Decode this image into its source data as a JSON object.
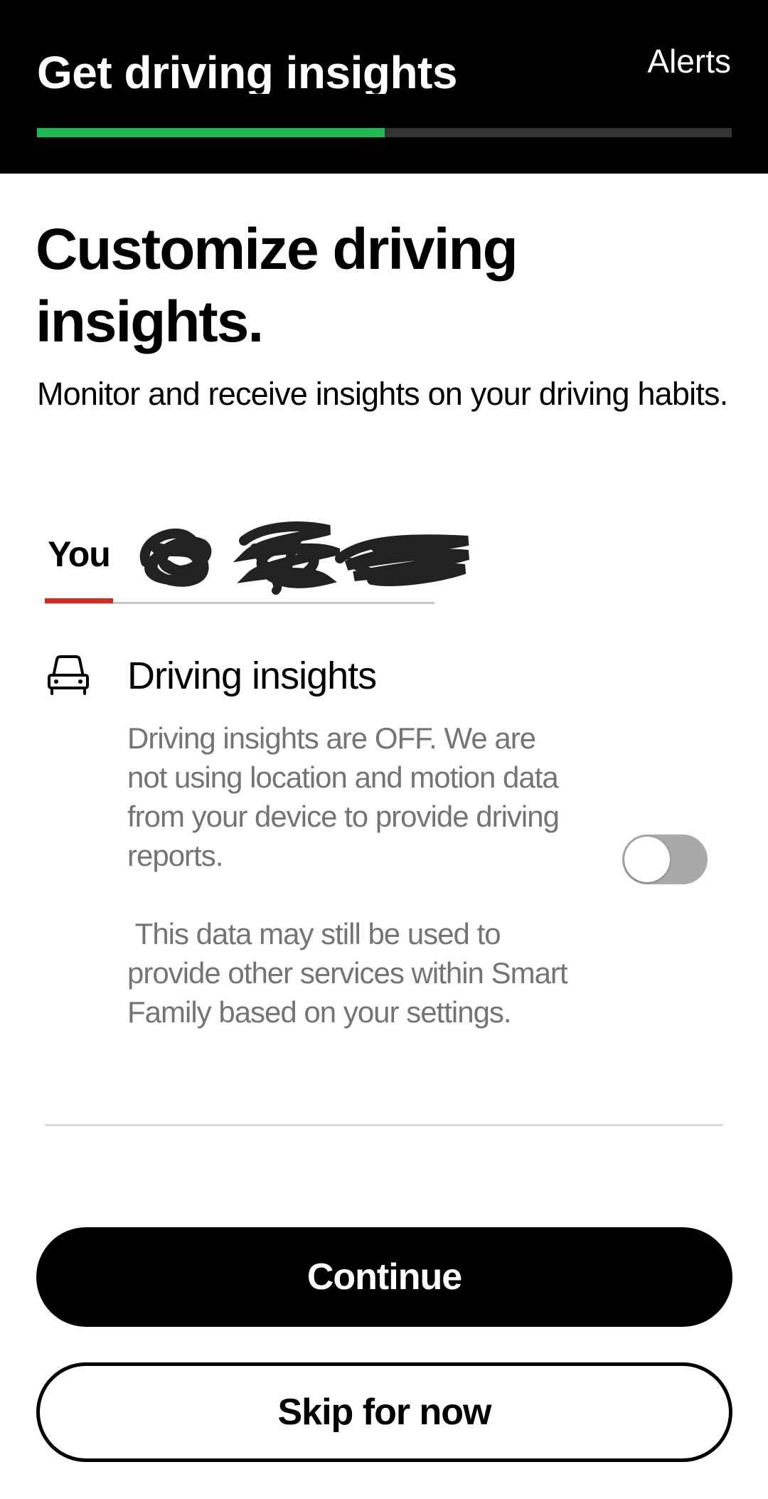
{
  "header": {
    "title": "Get driving insights",
    "alerts_label": "Alerts",
    "progress_fraction": 0.5,
    "progress_color": "#1db954"
  },
  "main": {
    "heading": "Customize driving insights.",
    "subheading": "Monitor and receive insights on your driving habits."
  },
  "tabs": {
    "active_label": "You",
    "active_underline_color": "#d52b1e"
  },
  "driving_insights": {
    "icon": "car-icon",
    "title": "Driving insights",
    "description": "Driving insights are OFF. We are not using location and motion data from your device to provide driving reports.",
    "note": " This data may still be used to provide other services within Smart Family based on your settings.",
    "toggle_on": false
  },
  "actions": {
    "continue_label": "Continue",
    "skip_label": "Skip for now"
  }
}
